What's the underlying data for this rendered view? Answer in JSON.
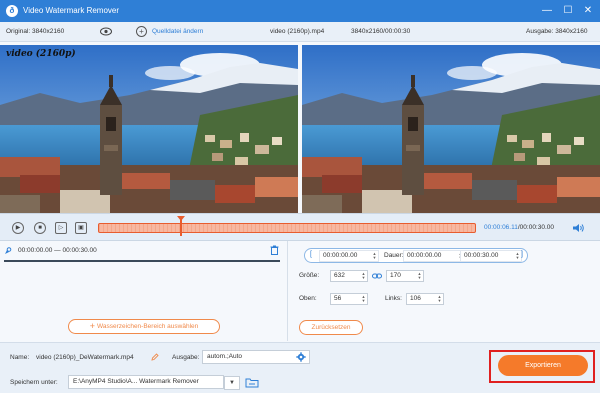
{
  "app": {
    "title": "Video Watermark Remover",
    "logo_glyph": "ð",
    "window_controls": [
      "—",
      "☐",
      "✕"
    ]
  },
  "infobar": {
    "original": "Original: 3840x2160",
    "change_source": "Quelldatei ändern",
    "file_name": "video (2160p).mp4",
    "file_info": "3840x2160/00:00:30",
    "output": "Ausgabe: 3840x2160"
  },
  "preview": {
    "watermark_text": "video (2160p)"
  },
  "timeline": {
    "current_time": "00:00:06.11",
    "total_time": "/00:00:30.00",
    "controls": [
      "▶",
      "■",
      "▷",
      "▣"
    ]
  },
  "clip": {
    "range": "00:00:00.00 — 00:00:30.00"
  },
  "buttons": {
    "add_area": "Wasserzeichen-Bereich auswählen",
    "reset": "Zurücksetzen",
    "export": "Exportieren"
  },
  "area": {
    "start": "00:00:00.00",
    "duration_label": "Dauer:",
    "duration": "00:00:00.00",
    "end": "00:00:30.00",
    "size_label": "Größe:",
    "width": "632",
    "height": "170",
    "top_label": "Oben:",
    "top": "56",
    "left_label": "Links:",
    "left": "106"
  },
  "bottom": {
    "name_label": "Name:",
    "name_value": "video (2160p)_DeWatermark.mp4",
    "output_label": "Ausgabe:",
    "output_value": "autom.;Auto",
    "save_label": "Speichern unter:",
    "save_path": "E:\\AnyMP4 Studio\\A... Watermark Remover"
  },
  "colors": {
    "accent": "#2f7fd6",
    "orange": "#f57a2a",
    "highlight": "#e02020"
  }
}
